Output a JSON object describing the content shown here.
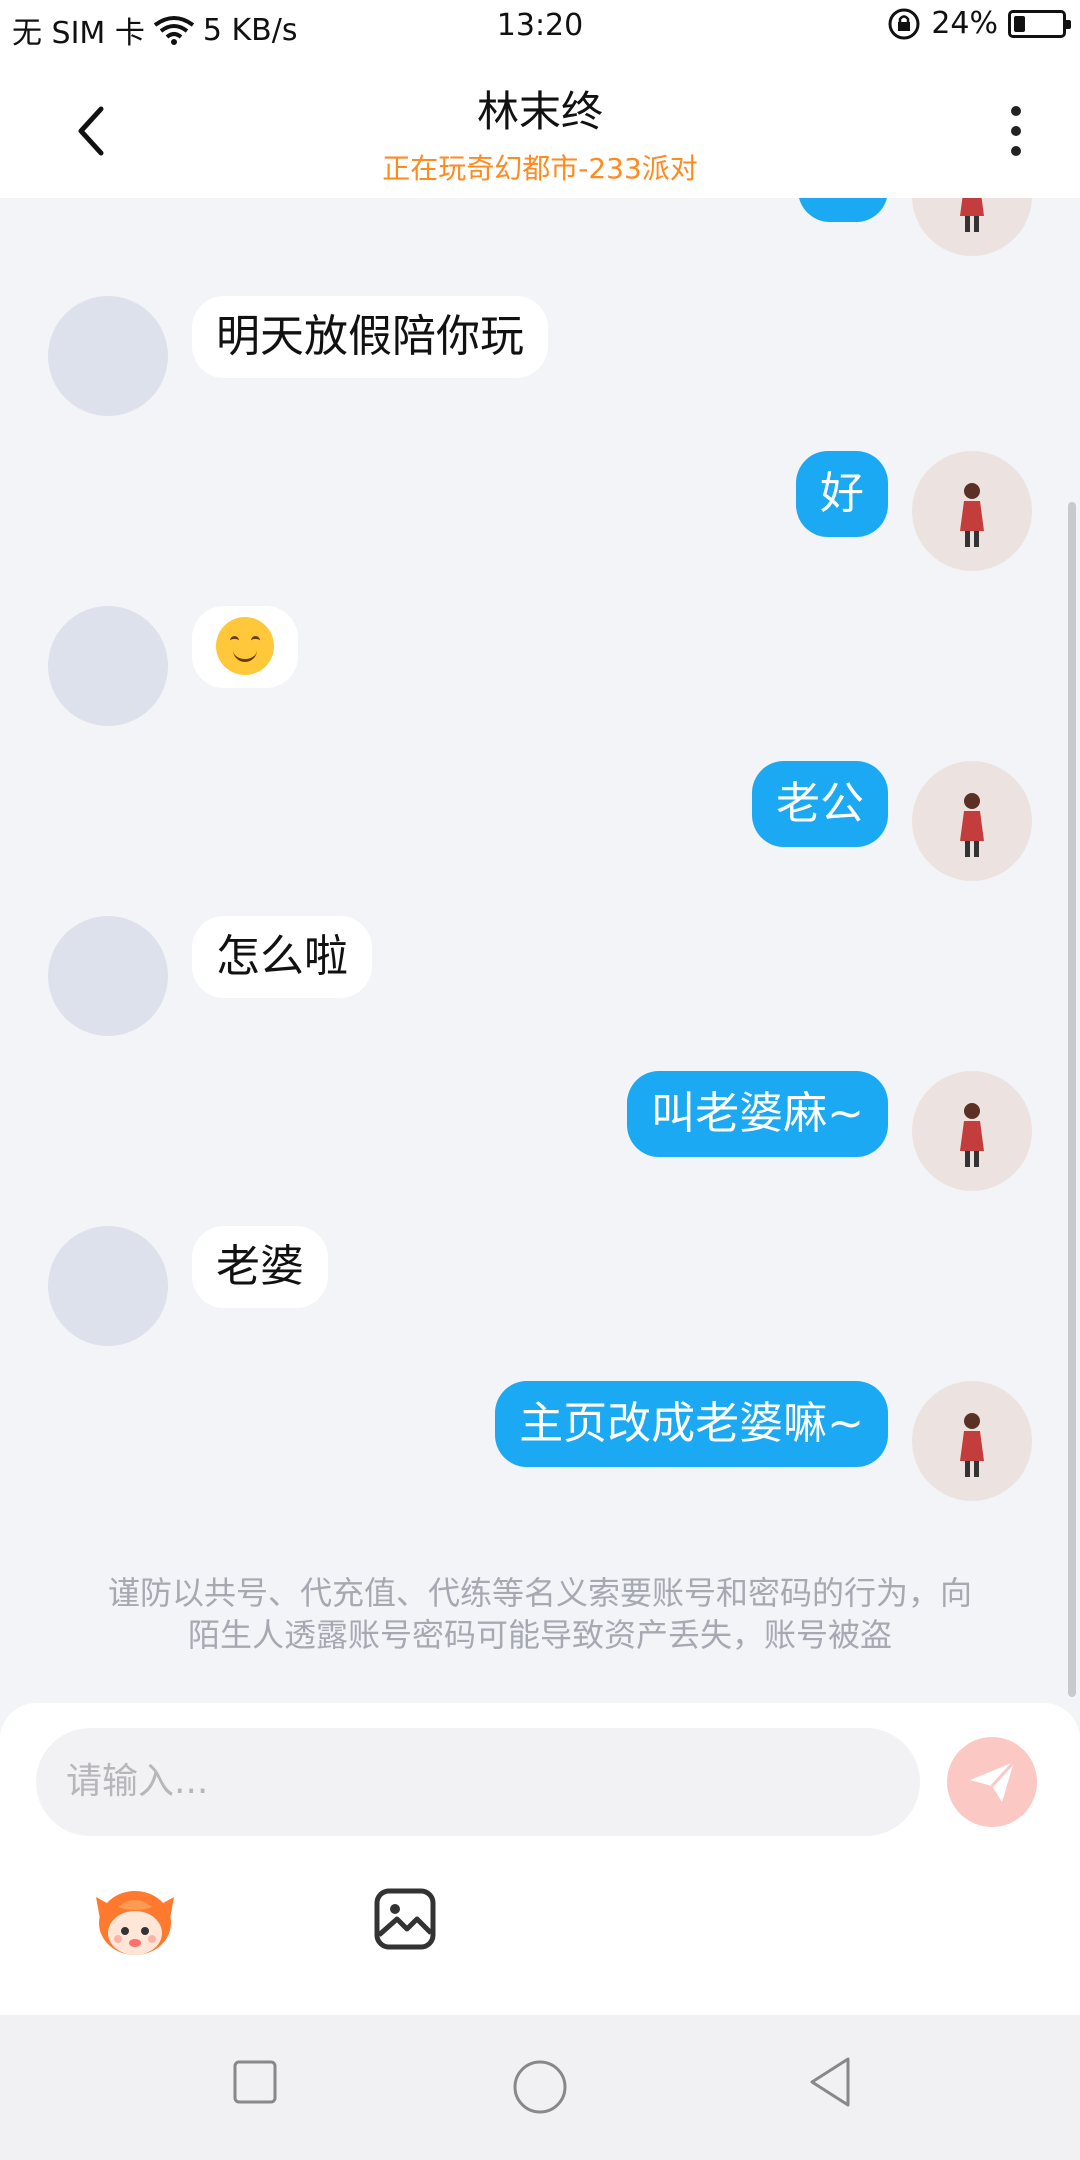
{
  "status_bar": {
    "carrier": "无 SIM 卡",
    "speed": "5 KB/s",
    "time": "13:20",
    "battery": "24%",
    "battery_level": 0.24
  },
  "header": {
    "title": "林末终",
    "subtitle": "正在玩奇幻都市-233派对",
    "back_icon": "chevron-left-icon",
    "more_icon": "more-vertical-icon"
  },
  "messages": [
    {
      "side": "left",
      "text": "明天放假陪你玩"
    },
    {
      "side": "right",
      "text": "好"
    },
    {
      "side": "left",
      "text": "😊",
      "kind": "emoji"
    },
    {
      "side": "right",
      "text": "老公"
    },
    {
      "side": "left",
      "text": "怎么啦"
    },
    {
      "side": "right",
      "text": "叫老婆麻~"
    },
    {
      "side": "left",
      "text": "老婆"
    },
    {
      "side": "right",
      "text": "主页改成老婆嘛~"
    }
  ],
  "warning": "谨防以共号、代充值、代练等名义索要账号和密码的行为，向陌生人透露账号密码可能导致资产丢失，账号被盗",
  "input": {
    "placeholder": "请输入...",
    "send_icon": "paper-plane-icon"
  },
  "toolbar": {
    "sticker_icon": "mascot-sticker-icon",
    "image_icon": "image-icon"
  },
  "nav": {
    "recent_icon": "square-icon",
    "home_icon": "circle-icon",
    "back_icon": "triangle-back-icon"
  },
  "colors": {
    "accent": "#1aa9f2",
    "subtitle": "#ff8a1e",
    "send_button": "#fbc8c4"
  }
}
